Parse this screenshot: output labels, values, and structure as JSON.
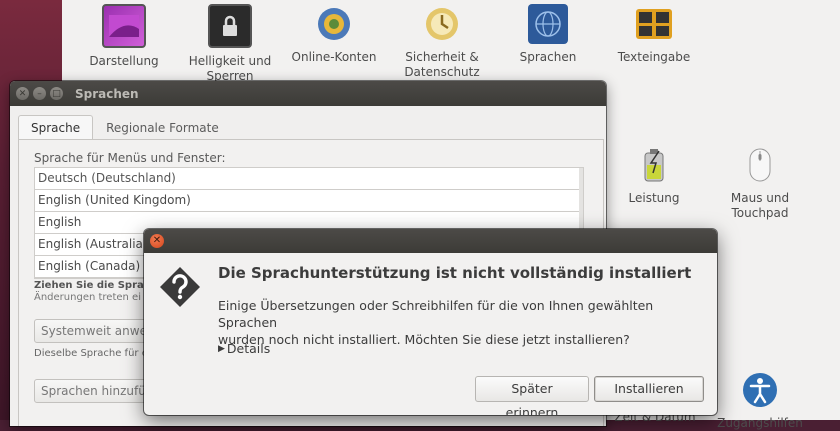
{
  "settings": {
    "items_top": [
      {
        "label": "Darstellung",
        "icon": "appearance-icon"
      },
      {
        "label": "Helligkeit und Sperren",
        "icon": "lock-screen-icon"
      },
      {
        "label": "Online-Konten",
        "icon": "online-accounts-icon"
      },
      {
        "label": "Sicherheit & Datenschutz",
        "icon": "privacy-icon"
      },
      {
        "label": "Sprachen",
        "icon": "globe-icon"
      },
      {
        "label": "Texteingabe",
        "icon": "keyboard-icon"
      }
    ],
    "items_mid": [
      {
        "label": "Leistung",
        "icon": "battery-icon"
      },
      {
        "label": "Maus und Touchpad",
        "icon": "mouse-icon"
      }
    ],
    "items_bottom": [
      {
        "label": "Zeit & Datum",
        "icon": "clock-icon"
      },
      {
        "label": "Zugangshilfen",
        "icon": "accessibility-icon"
      }
    ]
  },
  "language_window": {
    "title": "Sprachen",
    "tabs": [
      "Sprache",
      "Regionale Formate"
    ],
    "section_label": "Sprache für Menüs und Fenster:",
    "languages": [
      "Deutsch (Deutschland)",
      "English (United Kingdom)",
      "English",
      "English (Australia)",
      "English (Canada)"
    ],
    "hint_bold": "Ziehen Sie die Sprach",
    "hint": "Änderungen treten ei",
    "systemwide_button": "Systemweit anwe",
    "same_language_text": "Dieselbe Sprache für e",
    "add_languages_button": "Sprachen hinzufü"
  },
  "dialog": {
    "title": "Die Sprachunterstützung ist nicht vollständig installiert",
    "message_line1": "Einige Übersetzungen oder Schreibhilfen für die von Ihnen gewählten Sprachen",
    "message_line2": "wurden noch nicht installiert. Möchten Sie diese jetzt installieren?",
    "details_label": "Details",
    "later_button": "Später erinnern",
    "install_button": "Installieren"
  },
  "colors": {
    "titlebar": "#3c3b37",
    "window_bg": "#f2f1f0",
    "close_button": "#e5582b",
    "wallpaper": "#5a1f34"
  }
}
